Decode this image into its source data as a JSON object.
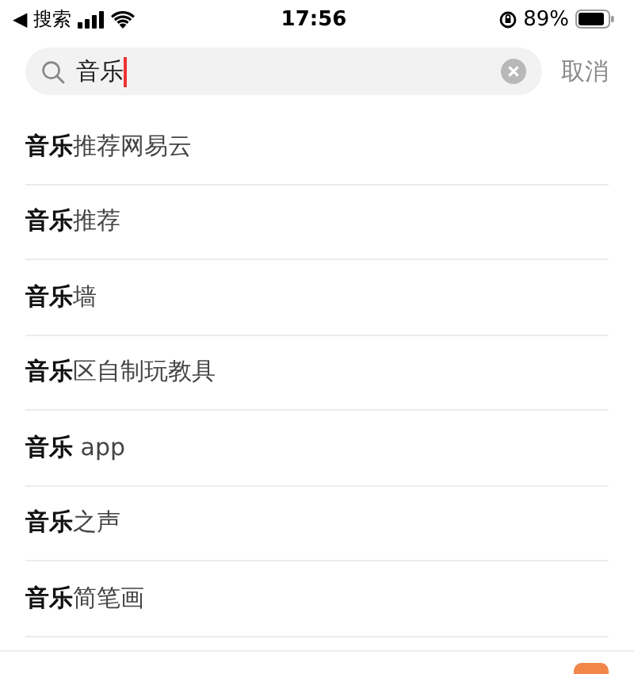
{
  "status_bar": {
    "back_label": "◀ 搜索",
    "time": "17:56",
    "battery": "89%"
  },
  "search": {
    "value": "音乐",
    "cancel": "取消"
  },
  "suggestions": [
    {
      "text": "**音乐**推荐网易云"
    },
    {
      "text": "**音乐**推荐"
    },
    {
      "text": "**音乐**墙"
    },
    {
      "text": "**音乐**区自制玩教具"
    },
    {
      "text": "**音乐** app"
    },
    {
      "text": "**音乐**之声"
    },
    {
      "text": "**音乐**简笔画"
    }
  ]
}
